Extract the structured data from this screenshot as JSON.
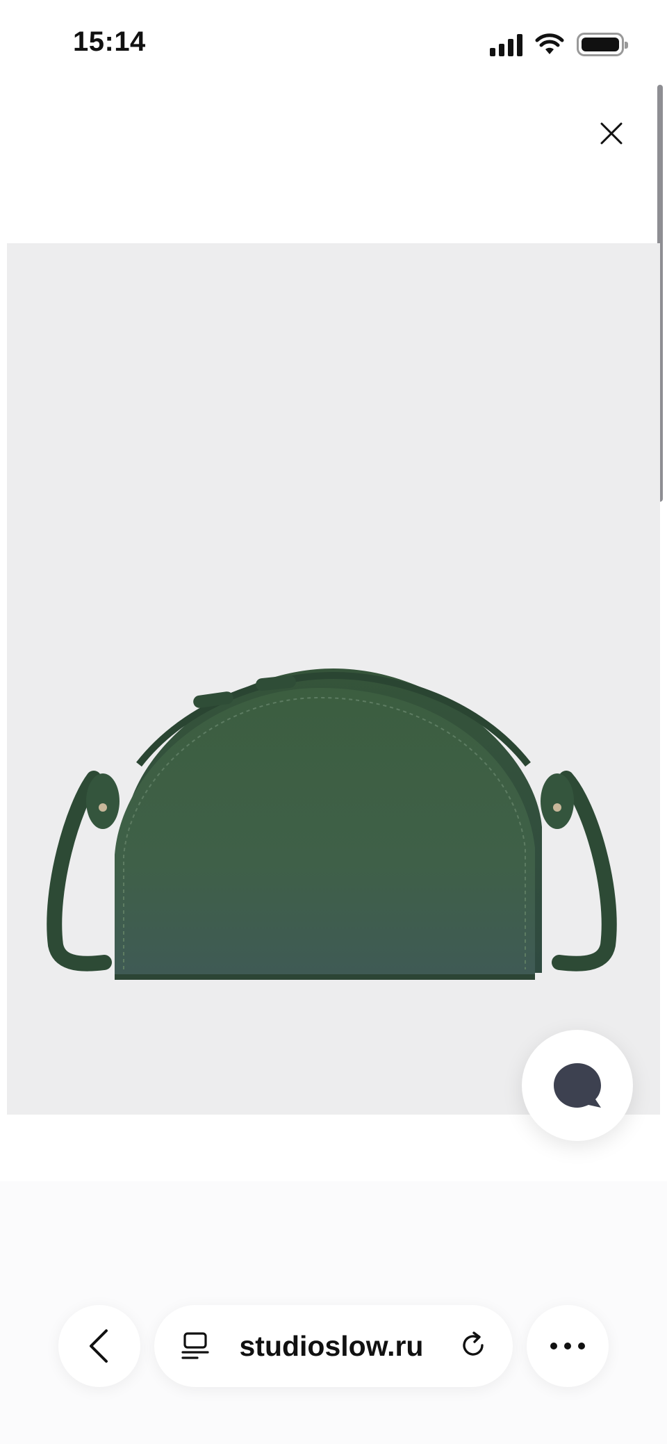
{
  "status_bar": {
    "time": "15:14",
    "icons": [
      "cellular-signal-icon",
      "wifi-icon",
      "battery-icon"
    ]
  },
  "viewer": {
    "close_icon": "close-icon",
    "image_subject": "green-leather-half-moon-crossbody-bag",
    "colors": {
      "background": "#ededee",
      "bag": "#3e5f47"
    }
  },
  "chat": {
    "icon": "chat-bubble-icon",
    "color": "#3d4150"
  },
  "browser_bar": {
    "back_icon": "chevron-left-icon",
    "reader_icon": "page-reader-icon",
    "url": "studioslow.ru",
    "reload_icon": "reload-icon",
    "more_icon": "more-dots-icon"
  }
}
